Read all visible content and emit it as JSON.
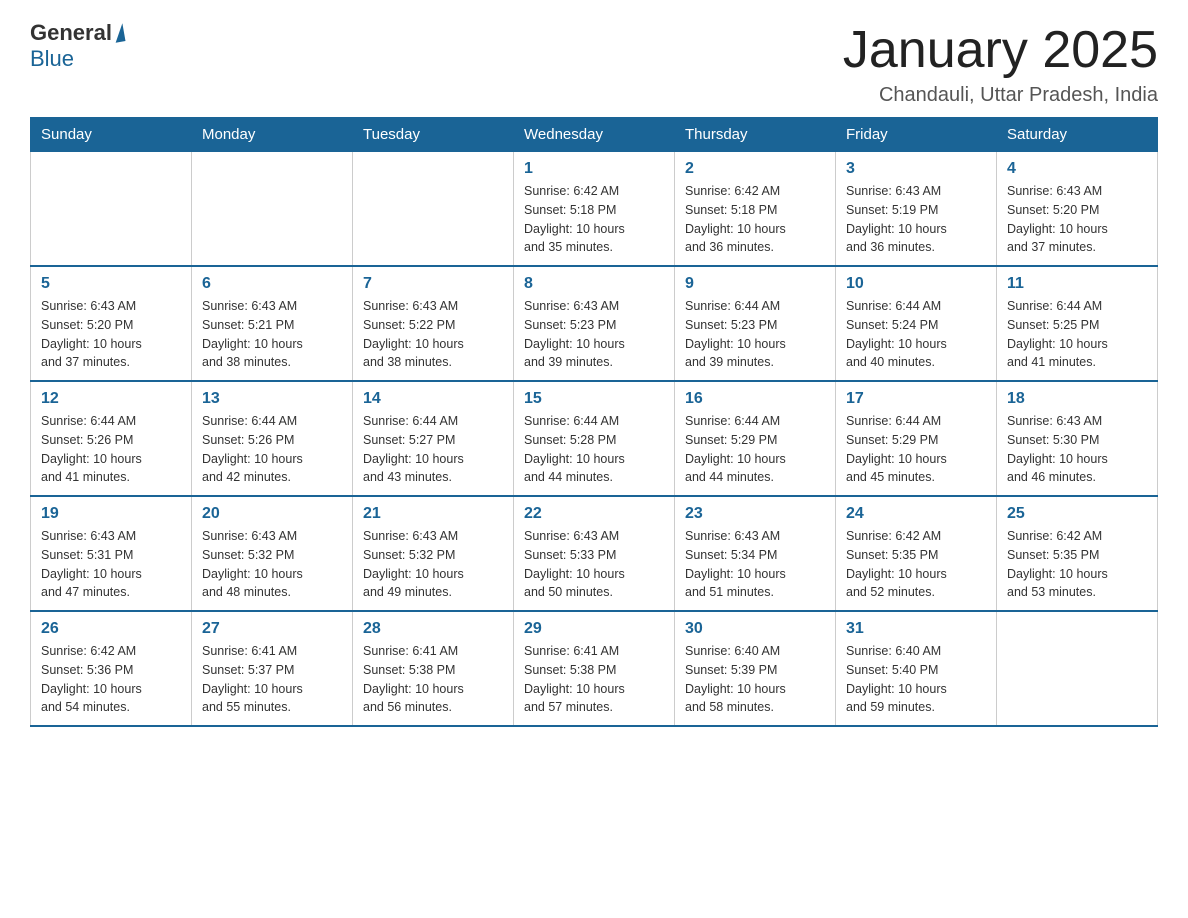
{
  "logo": {
    "general": "General",
    "blue": "Blue"
  },
  "title": "January 2025",
  "location": "Chandauli, Uttar Pradesh, India",
  "weekdays": [
    "Sunday",
    "Monday",
    "Tuesday",
    "Wednesday",
    "Thursday",
    "Friday",
    "Saturday"
  ],
  "weeks": [
    [
      {
        "day": "",
        "info": ""
      },
      {
        "day": "",
        "info": ""
      },
      {
        "day": "",
        "info": ""
      },
      {
        "day": "1",
        "info": "Sunrise: 6:42 AM\nSunset: 5:18 PM\nDaylight: 10 hours\nand 35 minutes."
      },
      {
        "day": "2",
        "info": "Sunrise: 6:42 AM\nSunset: 5:18 PM\nDaylight: 10 hours\nand 36 minutes."
      },
      {
        "day": "3",
        "info": "Sunrise: 6:43 AM\nSunset: 5:19 PM\nDaylight: 10 hours\nand 36 minutes."
      },
      {
        "day": "4",
        "info": "Sunrise: 6:43 AM\nSunset: 5:20 PM\nDaylight: 10 hours\nand 37 minutes."
      }
    ],
    [
      {
        "day": "5",
        "info": "Sunrise: 6:43 AM\nSunset: 5:20 PM\nDaylight: 10 hours\nand 37 minutes."
      },
      {
        "day": "6",
        "info": "Sunrise: 6:43 AM\nSunset: 5:21 PM\nDaylight: 10 hours\nand 38 minutes."
      },
      {
        "day": "7",
        "info": "Sunrise: 6:43 AM\nSunset: 5:22 PM\nDaylight: 10 hours\nand 38 minutes."
      },
      {
        "day": "8",
        "info": "Sunrise: 6:43 AM\nSunset: 5:23 PM\nDaylight: 10 hours\nand 39 minutes."
      },
      {
        "day": "9",
        "info": "Sunrise: 6:44 AM\nSunset: 5:23 PM\nDaylight: 10 hours\nand 39 minutes."
      },
      {
        "day": "10",
        "info": "Sunrise: 6:44 AM\nSunset: 5:24 PM\nDaylight: 10 hours\nand 40 minutes."
      },
      {
        "day": "11",
        "info": "Sunrise: 6:44 AM\nSunset: 5:25 PM\nDaylight: 10 hours\nand 41 minutes."
      }
    ],
    [
      {
        "day": "12",
        "info": "Sunrise: 6:44 AM\nSunset: 5:26 PM\nDaylight: 10 hours\nand 41 minutes."
      },
      {
        "day": "13",
        "info": "Sunrise: 6:44 AM\nSunset: 5:26 PM\nDaylight: 10 hours\nand 42 minutes."
      },
      {
        "day": "14",
        "info": "Sunrise: 6:44 AM\nSunset: 5:27 PM\nDaylight: 10 hours\nand 43 minutes."
      },
      {
        "day": "15",
        "info": "Sunrise: 6:44 AM\nSunset: 5:28 PM\nDaylight: 10 hours\nand 44 minutes."
      },
      {
        "day": "16",
        "info": "Sunrise: 6:44 AM\nSunset: 5:29 PM\nDaylight: 10 hours\nand 44 minutes."
      },
      {
        "day": "17",
        "info": "Sunrise: 6:44 AM\nSunset: 5:29 PM\nDaylight: 10 hours\nand 45 minutes."
      },
      {
        "day": "18",
        "info": "Sunrise: 6:43 AM\nSunset: 5:30 PM\nDaylight: 10 hours\nand 46 minutes."
      }
    ],
    [
      {
        "day": "19",
        "info": "Sunrise: 6:43 AM\nSunset: 5:31 PM\nDaylight: 10 hours\nand 47 minutes."
      },
      {
        "day": "20",
        "info": "Sunrise: 6:43 AM\nSunset: 5:32 PM\nDaylight: 10 hours\nand 48 minutes."
      },
      {
        "day": "21",
        "info": "Sunrise: 6:43 AM\nSunset: 5:32 PM\nDaylight: 10 hours\nand 49 minutes."
      },
      {
        "day": "22",
        "info": "Sunrise: 6:43 AM\nSunset: 5:33 PM\nDaylight: 10 hours\nand 50 minutes."
      },
      {
        "day": "23",
        "info": "Sunrise: 6:43 AM\nSunset: 5:34 PM\nDaylight: 10 hours\nand 51 minutes."
      },
      {
        "day": "24",
        "info": "Sunrise: 6:42 AM\nSunset: 5:35 PM\nDaylight: 10 hours\nand 52 minutes."
      },
      {
        "day": "25",
        "info": "Sunrise: 6:42 AM\nSunset: 5:35 PM\nDaylight: 10 hours\nand 53 minutes."
      }
    ],
    [
      {
        "day": "26",
        "info": "Sunrise: 6:42 AM\nSunset: 5:36 PM\nDaylight: 10 hours\nand 54 minutes."
      },
      {
        "day": "27",
        "info": "Sunrise: 6:41 AM\nSunset: 5:37 PM\nDaylight: 10 hours\nand 55 minutes."
      },
      {
        "day": "28",
        "info": "Sunrise: 6:41 AM\nSunset: 5:38 PM\nDaylight: 10 hours\nand 56 minutes."
      },
      {
        "day": "29",
        "info": "Sunrise: 6:41 AM\nSunset: 5:38 PM\nDaylight: 10 hours\nand 57 minutes."
      },
      {
        "day": "30",
        "info": "Sunrise: 6:40 AM\nSunset: 5:39 PM\nDaylight: 10 hours\nand 58 minutes."
      },
      {
        "day": "31",
        "info": "Sunrise: 6:40 AM\nSunset: 5:40 PM\nDaylight: 10 hours\nand 59 minutes."
      },
      {
        "day": "",
        "info": ""
      }
    ]
  ]
}
